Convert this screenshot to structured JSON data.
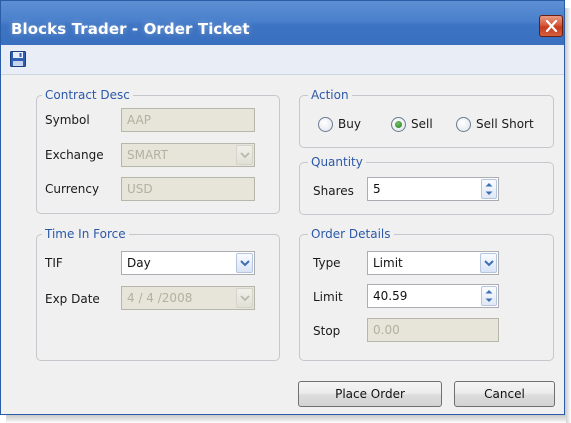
{
  "window": {
    "title": "Blocks Trader - Order Ticket"
  },
  "toolbar": {
    "save_icon": "floppy-disk-icon"
  },
  "contract": {
    "legend": "Contract Desc",
    "symbol_label": "Symbol",
    "symbol_value": "AAP",
    "exchange_label": "Exchange",
    "exchange_value": "SMART",
    "currency_label": "Currency",
    "currency_value": "USD"
  },
  "action": {
    "legend": "Action",
    "options": [
      {
        "label": "Buy",
        "selected": false
      },
      {
        "label": "Sell",
        "selected": true
      },
      {
        "label": "Sell Short",
        "selected": false
      }
    ]
  },
  "quantity": {
    "legend": "Quantity",
    "shares_label": "Shares",
    "shares_value": "5"
  },
  "tif": {
    "legend": "Time In Force",
    "tif_label": "TIF",
    "tif_value": "Day",
    "exp_label": "Exp Date",
    "exp_value": "4 / 4 /2008"
  },
  "order": {
    "legend": "Order Details",
    "type_label": "Type",
    "type_value": "Limit",
    "limit_label": "Limit",
    "limit_value": "40.59",
    "stop_label": "Stop",
    "stop_value": "0.00"
  },
  "buttons": {
    "place_order": "Place Order",
    "cancel": "Cancel"
  },
  "colors": {
    "title_bar": "#4a80cc",
    "group_legend": "#2c58a8",
    "close_button": "#d14a2a",
    "selected_radio": "#2a8a23"
  }
}
